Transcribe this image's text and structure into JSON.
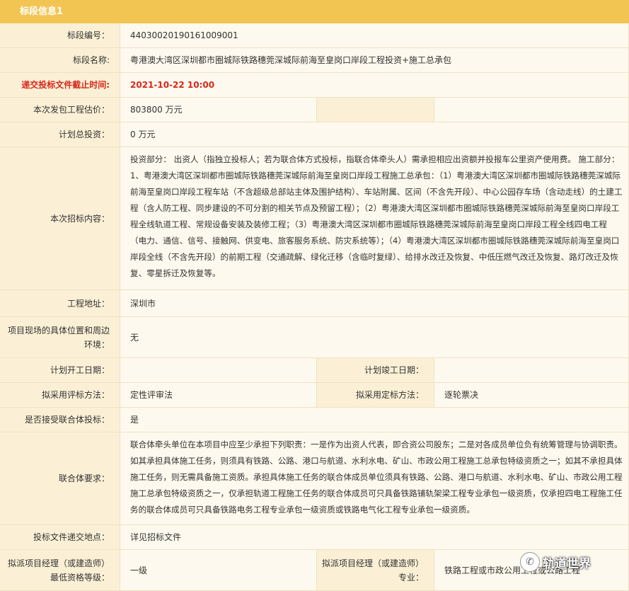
{
  "section_title": "标段信息1",
  "rows": {
    "r1": {
      "label": "标段编号：",
      "value": "44030020190161009001"
    },
    "r2": {
      "label": "标段名称:",
      "value": "粤港澳大湾区深圳都市圈城际铁路穗莞深城际前海至皇岗口岸段工程投资+施工总承包"
    },
    "r3": {
      "label": "递交投标文件截止时间:",
      "value": "2021-10-22 10:00"
    },
    "r4": {
      "label": "本次发包工程估价：",
      "value": "803800 万元"
    },
    "r5": {
      "label": "计划总投资：",
      "value": "0 万元"
    },
    "r6": {
      "label": "本次招标内容：",
      "value": "投资部分： 出资人（指独立投标人；若为联合体方式投标，指联合体牵头人）需承担相应出资额并投报车公里资产使用费。 施工部分： 1、粤港澳大湾区深圳都市圈城际铁路穗莞深城际前海至皇岗口岸段工程施工总承包：（1）粤港澳大湾区深圳都市圈城际铁路穗莞深城际前海至皇岗口岸段工程车站（不含超级总部站主体及围护结构）、车站附属、区间（不含先开段）、中心公园存车场（含动走线）的土建工程（含人防工程、同步建设的不可分割的相关节点及预留工程）；（2）粤港澳大湾区深圳都市圈城际铁路穗莞深城际前海至皇岗口岸段工程全线轨道工程、常规设备安装及装修工程；（3）粤港澳大湾区深圳都市圈城际铁路穗莞深城际前海至皇岗口岸段工程全线四电工程（电力、通信、信号、接触网、供变电、旅客服务系统、防灾系统等）；（4）粤港澳大湾区深圳都市圈城际铁路穗莞深城际前海至皇岗口岸段全线（不含先开段）的前期工程（交通疏解、绿化迁移（含临时复绿）、给排水改迁及恢复、中低压燃气改迁及恢复、路灯改迁及恢复、零星拆迁及恢复等。"
    },
    "r7": {
      "label": "工程地址：",
      "value": "深圳市"
    },
    "r8": {
      "label": "项目现场的具体位置和周边环境：",
      "value": "无"
    },
    "r9": {
      "label": "计划开工日期：",
      "value": "",
      "label2": "计划竣工日期：",
      "value2": ""
    },
    "r10": {
      "label": "拟采用评标方法：",
      "value": "定性评审法",
      "label2": "拟采用定标方法：",
      "value2": "逐轮票决"
    },
    "r11": {
      "label": "是否接受联合体投标：",
      "value": "是"
    },
    "r12": {
      "label": "联合体要求：",
      "value": "联合体牵头单位在本项目中应至少承担下列职责：一是作为出资人代表，即合资公司股东；二是对各成员单位负有统筹管理与协调职责。如其承担具体施工任务，则须具有铁路、公路、港口与航道、水利水电、矿山、市政公用工程施工总承包特级资质之一；如其不承担具体施工任务，则无需具备施工资质。承担具体施工任务的联合体成员单位须具有铁路、公路、港口与航道、水利水电、矿山、市政公用工程施工总承包特级资质之一，仅承担轨道工程施工任务的联合体成员可只具备铁路铺轨架梁工程专业承包一级资质，仅承担四电工程施工任务的联合体成员可只具备铁路电务工程专业承包一级资质或铁路电气化工程专业承包一级资质。"
    },
    "r13": {
      "label": "投标文件递交地点：",
      "value": "详见招标文件"
    },
    "r14": {
      "label": "拟派项目经理（或建造师）最低资格等级：",
      "value": "一级",
      "label2": "拟派项目经理（或建造师）专业：",
      "value2": "铁路工程或市政公用工程或公路工程"
    }
  },
  "watermark": {
    "text": "轨道世界",
    "icon": "wechat-icon"
  },
  "colors": {
    "header": "#f2c552",
    "label_bg": "#fbf0d5",
    "value_bg": "#fdf9ee",
    "deadline_red": "#d9261c",
    "border": "#efe2c3"
  }
}
